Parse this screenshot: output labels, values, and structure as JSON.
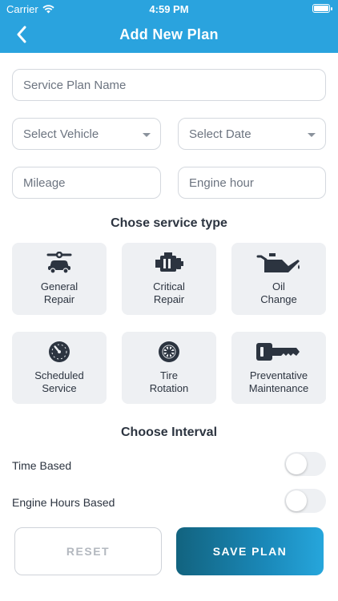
{
  "status_bar": {
    "carrier": "Carrier",
    "time": "4:59 PM"
  },
  "header": {
    "title": "Add New Plan",
    "back_icon": "chevron-left-icon"
  },
  "form": {
    "service_plan_name_placeholder": "Service Plan Name",
    "select_vehicle_placeholder": "Select Vehicle",
    "select_date_placeholder": "Select Date",
    "mileage_placeholder": "Mileage",
    "engine_hour_placeholder": "Engine hour"
  },
  "service_type": {
    "title": "Chose service type",
    "items": [
      {
        "label": "General\nRepair",
        "icon": "car-wrench-icon"
      },
      {
        "label": "Critical\nRepair",
        "icon": "engine-icon"
      },
      {
        "label": "Oil\nChange",
        "icon": "oil-can-icon"
      },
      {
        "label": "Scheduled\nService",
        "icon": "speedometer-icon"
      },
      {
        "label": "Tire\nRotation",
        "icon": "tire-icon"
      },
      {
        "label": "Preventative\nMaintenance",
        "icon": "key-icon"
      }
    ]
  },
  "interval": {
    "title": "Choose Interval",
    "options": [
      {
        "label": "Time Based",
        "enabled": false
      },
      {
        "label": "Engine Hours Based",
        "enabled": false
      }
    ]
  },
  "footer": {
    "reset_label": "RESET",
    "save_label": "SAVE PLAN"
  },
  "colors": {
    "header": "#2aa3de",
    "tile_bg": "#eef0f3",
    "save_start": "#12637f",
    "save_end": "#26a6dc"
  }
}
